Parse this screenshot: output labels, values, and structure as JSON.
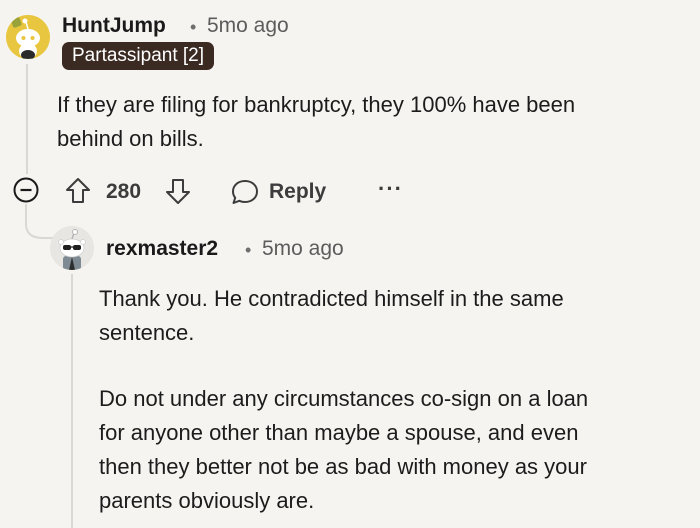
{
  "comment": {
    "author": "HuntJump",
    "separator": "•",
    "time": "5mo ago",
    "flair": "Partassipant [2]",
    "body": "If they are filing for bankruptcy, they 100% have been behind on bills.",
    "body_lines": [
      "If they are filing for bankruptcy, they 100% have been",
      "behind on bills."
    ],
    "votes": "280",
    "reply_label": "Reply",
    "more_label": "···",
    "icons": [
      "collapse-icon",
      "upvote-icon",
      "downvote-icon",
      "reply-bubble-icon",
      "more-icon"
    ]
  },
  "reply": {
    "author": "rexmaster2",
    "separator": "•",
    "time": "5mo ago",
    "paragraph1_lines": [
      "Thank you. He contradicted himself in the same",
      "sentence."
    ],
    "paragraph2_lines": [
      "Do not under any circumstances co-sign on a loan",
      "for anyone other than maybe a spouse, and even",
      "then they better not be as bad with money as your",
      "parents obviously are."
    ]
  },
  "colors": {
    "background": "#f5f4f0",
    "flair_bg": "#3a2a22",
    "avatar1": "#e8c640",
    "thread_line": "#d9d8d3"
  }
}
